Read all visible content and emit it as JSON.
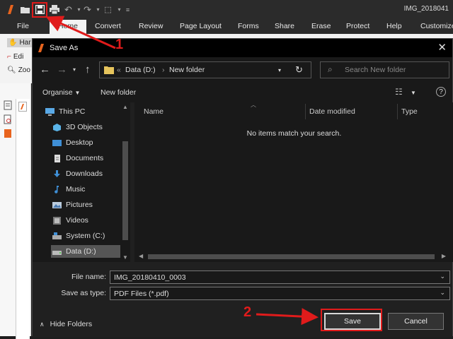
{
  "app": {
    "title": "IMG_2018041",
    "menu": [
      "File",
      "Home",
      "Convert",
      "Review",
      "Page Layout",
      "Forms",
      "Share",
      "Erase",
      "Protect",
      "Help",
      "Customize"
    ],
    "tools": [
      "Har",
      "Edi",
      "Zoo"
    ]
  },
  "dialog": {
    "title": "Save As",
    "path": {
      "prefix": "«",
      "segments": [
        "Data (D:)",
        "New folder"
      ]
    },
    "search_placeholder": "Search New folder",
    "commands": {
      "organise": "Organise",
      "new_folder": "New folder"
    },
    "tree": [
      {
        "label": "This PC",
        "icon": "pc-icon"
      },
      {
        "label": "3D Objects",
        "icon": "cube-icon"
      },
      {
        "label": "Desktop",
        "icon": "desktop-icon"
      },
      {
        "label": "Documents",
        "icon": "documents-icon"
      },
      {
        "label": "Downloads",
        "icon": "download-icon"
      },
      {
        "label": "Music",
        "icon": "music-icon"
      },
      {
        "label": "Pictures",
        "icon": "pictures-icon"
      },
      {
        "label": "Videos",
        "icon": "videos-icon"
      },
      {
        "label": "System (C:)",
        "icon": "drive-icon"
      },
      {
        "label": "Data (D:)",
        "icon": "drive-icon",
        "selected": true
      }
    ],
    "columns": [
      "Name",
      "Date modified",
      "Type"
    ],
    "empty_message": "No items match your search.",
    "file_name_label": "File name:",
    "file_name_value": "IMG_20180410_0003",
    "save_type_label": "Save as type:",
    "save_type_value": "PDF Files (*.pdf)",
    "hide_folders": "Hide Folders",
    "save_button": "Save",
    "cancel_button": "Cancel"
  },
  "annotations": {
    "step1": "1",
    "step2": "2",
    "color": "#e01b1b"
  }
}
